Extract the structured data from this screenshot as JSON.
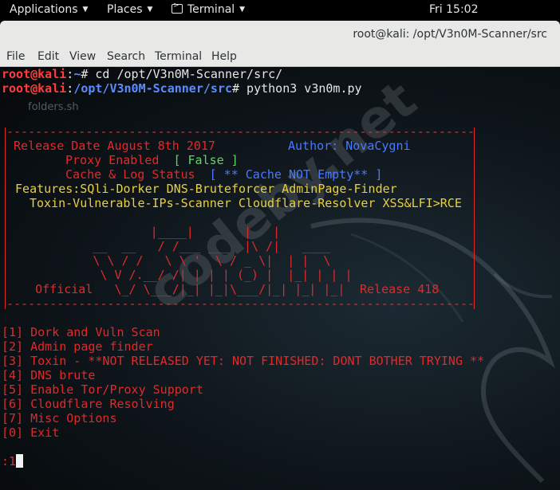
{
  "topbar": {
    "applications": "Applications",
    "places": "Places",
    "terminal": "Terminal",
    "clock": "Fri 15:02"
  },
  "window": {
    "title": "root@kali: /opt/V3n0M-Scanner/src"
  },
  "menubar": [
    "File",
    "Edit",
    "View",
    "Search",
    "Terminal",
    "Help"
  ],
  "prompt": {
    "user": "root@kali",
    "line1_path": "~",
    "line1_cmd": "# cd /opt/V3n0M-Scanner/src/",
    "line2_path": "/opt/V3n0M-Scanner/src",
    "line2_cmd": "# python3 v3n0m.py",
    "faint_file": "folders.sh"
  },
  "banner": {
    "border": "-----------------------------------------------------------------",
    "release_date": " Release Date August 8th 2017",
    "author": "Author: NovaCygni",
    "proxy_label": "Proxy Enabled",
    "proxy_value": "[ False ]",
    "cache_label": "Cache & Log Status",
    "cache_value": "[ ** Cache NOT Empty** ]",
    "features1": " Features:SQli-Dorker DNS-Bruteforcer AdminPage-Finder",
    "features2": "Toxin-Vulnerable-IPs-Scanner Cloudflare-Resolver XSS&LFI>RCE",
    "art": [
      "                    |____|       |   |",
      "            __  __   / /___ ___  |\\ /|   ____",
      "            \\ \\ / /   \\ \\ '  \\ / _ \\|  | |  \\",
      "             \\ V /.__/ /| | | | (_) |  |_| | | |",
      "    Official   \\_/ \\___/|_| |_|\\___/|_| |_| |_|"
    ],
    "release": "Release 418"
  },
  "menu_options": [
    "[1] Dork and Vuln Scan",
    "[2] Admin page finder",
    "[3] Toxin - **NOT RELEASED YET: NOT FINISHED: DONT BOTHER TRYING **",
    "[4] DNS brute",
    "[5] Enable Tor/Proxy Support",
    "[6] Cloudflare Resolving",
    "[7] Misc Options",
    "[0] Exit"
  ],
  "input_prompt": ":1",
  "watermark": "codeby.net",
  "colors": {
    "prompt_red": "#ff3d3d",
    "path_blue": "#5b8cff",
    "menu_red": "#e02a2a",
    "feature_yellow": "#e8d040",
    "false_green": "#5fd75f"
  }
}
